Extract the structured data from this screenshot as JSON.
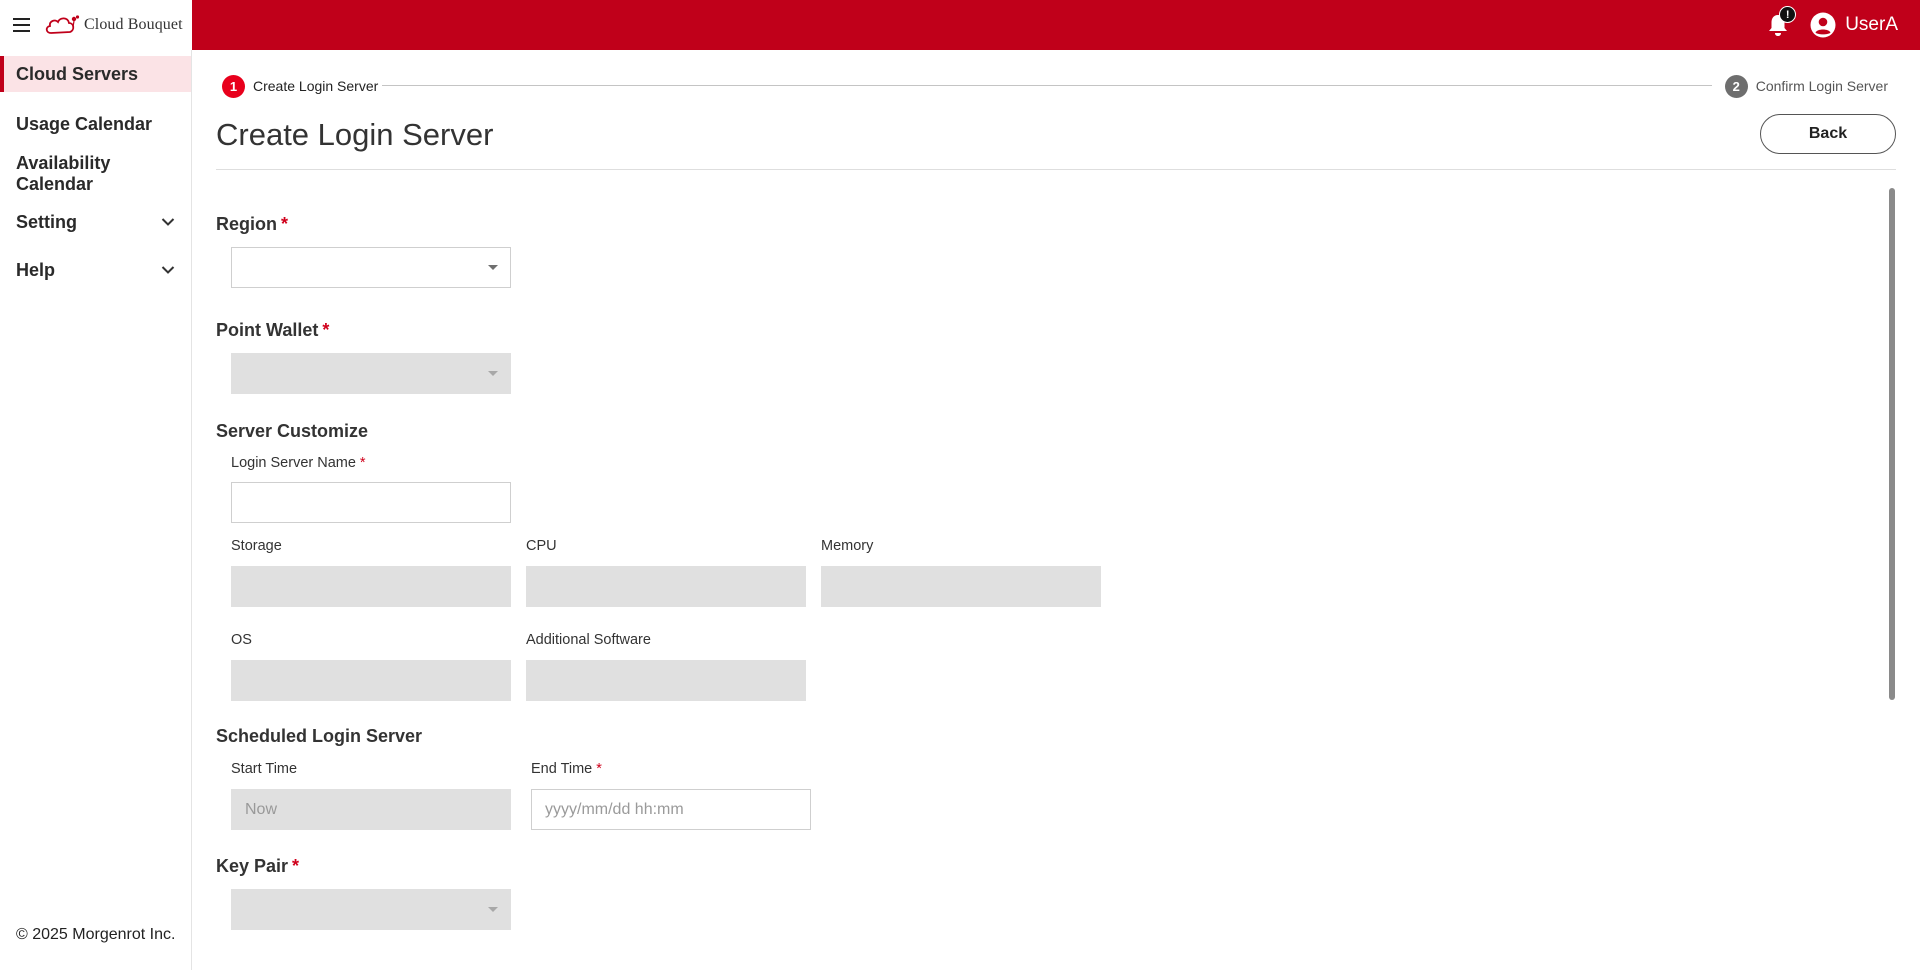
{
  "app": {
    "brand": "Cloud Bouquet"
  },
  "header": {
    "notification_count": "!",
    "user_name": "UserA"
  },
  "sidebar": {
    "items": [
      {
        "label": "Cloud Servers"
      },
      {
        "label": "Usage Calendar"
      },
      {
        "label": "Availability Calendar"
      },
      {
        "label": "Setting"
      },
      {
        "label": "Help"
      }
    ],
    "copyright": "© 2025 Morgenrot Inc."
  },
  "stepper": {
    "steps": [
      {
        "number": "1",
        "label": "Create Login Server"
      },
      {
        "number": "2",
        "label": "Confirm Login Server"
      }
    ]
  },
  "page": {
    "title": "Create Login Server",
    "back_label": "Back"
  },
  "form": {
    "region": {
      "label": "Region",
      "value": ""
    },
    "point_wallet": {
      "label": "Point Wallet",
      "value": ""
    },
    "server_customize": {
      "label": "Server Customize",
      "login_server_name": {
        "label": "Login Server Name",
        "value": ""
      },
      "storage": {
        "label": "Storage",
        "value": ""
      },
      "cpu": {
        "label": "CPU",
        "value": ""
      },
      "memory": {
        "label": "Memory",
        "value": ""
      },
      "os": {
        "label": "OS",
        "value": ""
      },
      "additional_software": {
        "label": "Additional Software",
        "value": ""
      }
    },
    "schedule": {
      "label": "Scheduled Login Server",
      "start_time": {
        "label": "Start Time",
        "value": "Now"
      },
      "end_time": {
        "label": "End Time",
        "placeholder": "yyyy/mm/dd hh:mm"
      }
    },
    "key_pair": {
      "label": "Key Pair",
      "value": ""
    },
    "required_mark": "*"
  },
  "colors": {
    "brand": "#c0001a",
    "active_nav_bg": "#fbe3e6",
    "step_active": "#e8001c",
    "step_inactive": "#6e6e6e",
    "disabled_field": "#e0e0e0"
  },
  "icons": {
    "menu": "menu-icon",
    "logo": "cloud-bouquet-logo-icon",
    "bell": "bell-icon",
    "user": "account-circle-icon",
    "chevron": "chevron-down-icon",
    "caret": "caret-down-icon"
  }
}
